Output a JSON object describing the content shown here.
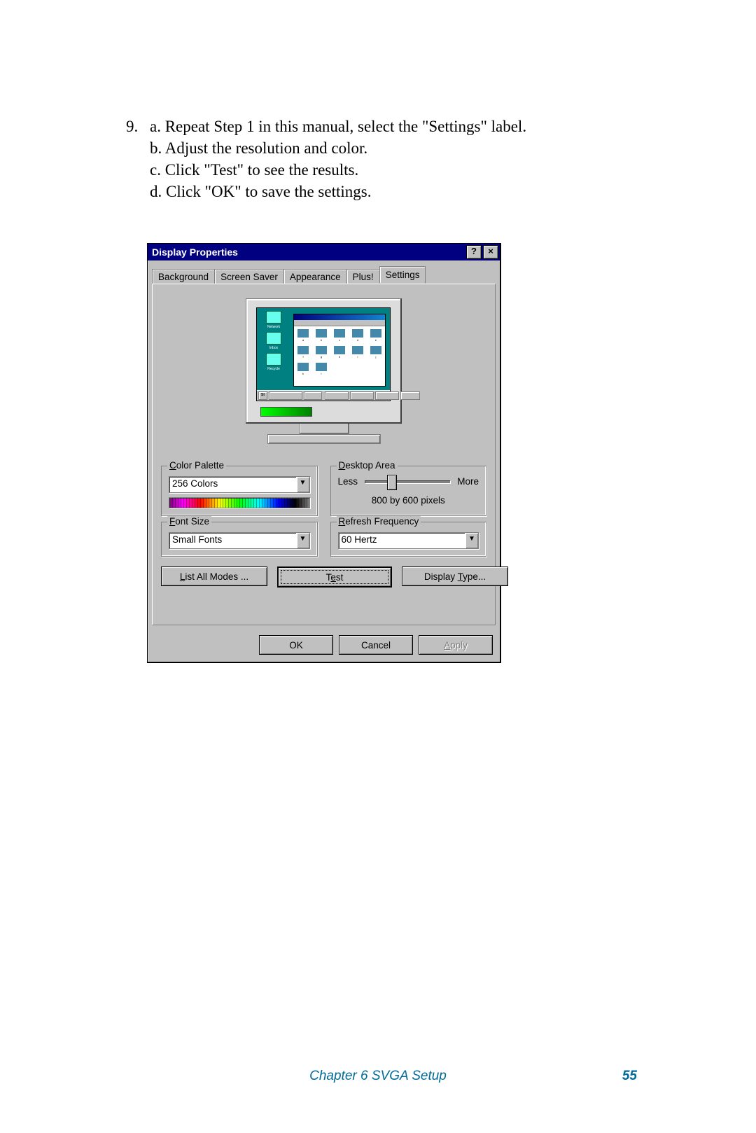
{
  "instructions": {
    "number": "9.",
    "a": "a. Repeat Step 1 in this manual, select the \"Settings\" label.",
    "b": "b. Adjust the resolution and color.",
    "c": "c. Click \"Test\" to see the results.",
    "d": "d. Click \"OK\" to save the settings."
  },
  "dialog": {
    "title": "Display Properties",
    "help_glyph": "?",
    "close_glyph": "×",
    "tabs": {
      "background": "Background",
      "screensaver": "Screen Saver",
      "appearance": "Appearance",
      "plus": "Plus!",
      "settings": "Settings"
    },
    "color_palette": {
      "legend_prefix": "C",
      "legend_rest": "olor Palette",
      "value": "256 Colors"
    },
    "desktop_area": {
      "legend_prefix": "D",
      "legend_rest": "esktop Area",
      "less": "Less",
      "more": "More",
      "resolution": "800 by 600 pixels"
    },
    "font_size": {
      "legend_prefix": "F",
      "legend_rest": "ont Size",
      "value": "Small Fonts"
    },
    "refresh": {
      "legend_prefix": "R",
      "legend_rest": "efresh Frequency",
      "value": "60 Hertz"
    },
    "buttons": {
      "list_modes_prefix": "L",
      "list_modes_rest": "ist All Modes ...",
      "test_prefix": "T",
      "test_mid": "e",
      "test_rest": "st",
      "display_type_pre": "Display ",
      "display_type_u": "T",
      "display_type_post": "ype...",
      "ok": "OK",
      "cancel": "Cancel",
      "apply_prefix": "A",
      "apply_rest": "pply"
    }
  },
  "footer": {
    "chapter": "Chapter 6   SVGA Setup",
    "page": "55"
  }
}
